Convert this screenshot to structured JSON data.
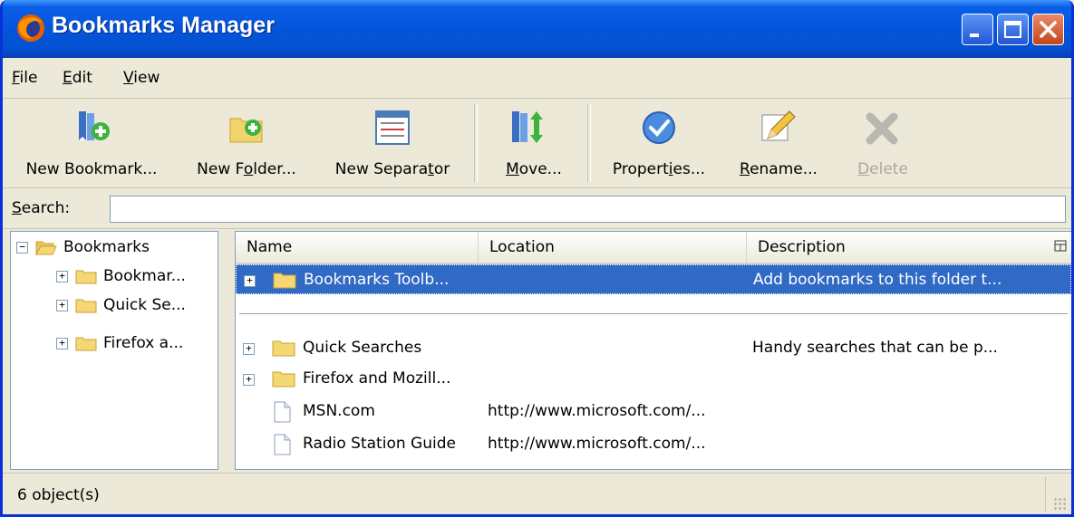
{
  "window": {
    "title": "Bookmarks Manager"
  },
  "menu": {
    "file": {
      "mnemonic": "F",
      "rest": "ile"
    },
    "edit": {
      "mnemonic": "E",
      "rest": "dit"
    },
    "view": {
      "mnemonic": "V",
      "rest": "iew"
    }
  },
  "toolbar": {
    "new_bookmark": "New Bookmark...",
    "new_folder": {
      "a": "New F",
      "u": "o",
      "b": "lder..."
    },
    "new_separator": {
      "a": "New Separa",
      "u": "t",
      "b": "or"
    },
    "move": {
      "a": "",
      "u": "M",
      "b": "ove..."
    },
    "properties": {
      "a": "Propert",
      "u": "i",
      "b": "es..."
    },
    "rename": {
      "a": "",
      "u": "R",
      "b": "ename..."
    },
    "delete": {
      "a": "",
      "u": "D",
      "b": "elete"
    }
  },
  "search": {
    "label_u": "S",
    "label_rest": "earch:",
    "value": ""
  },
  "tree": {
    "root": "Bookmarks",
    "items": [
      "Bookmar...",
      "Quick Se...",
      "Firefox a..."
    ]
  },
  "list": {
    "columns": [
      "Name",
      "Location",
      "Description"
    ],
    "rows": [
      {
        "name": "Bookmarks Toolb...",
        "location": "",
        "description": "Add bookmarks to this folder t..."
      },
      {
        "name": "Quick Searches",
        "location": "",
        "description": "Handy searches that can be p..."
      },
      {
        "name": "Firefox and Mozill...",
        "location": "",
        "description": ""
      },
      {
        "name": "MSN.com",
        "location": "http://www.microsoft.com/...",
        "description": ""
      },
      {
        "name": "Radio Station Guide",
        "location": "http://www.microsoft.com/...",
        "description": ""
      }
    ]
  },
  "status": {
    "text": "6 object(s)"
  },
  "colors": {
    "title_bar": "#0455dc",
    "selection": "#316ac5",
    "folder": "#f5d874"
  }
}
